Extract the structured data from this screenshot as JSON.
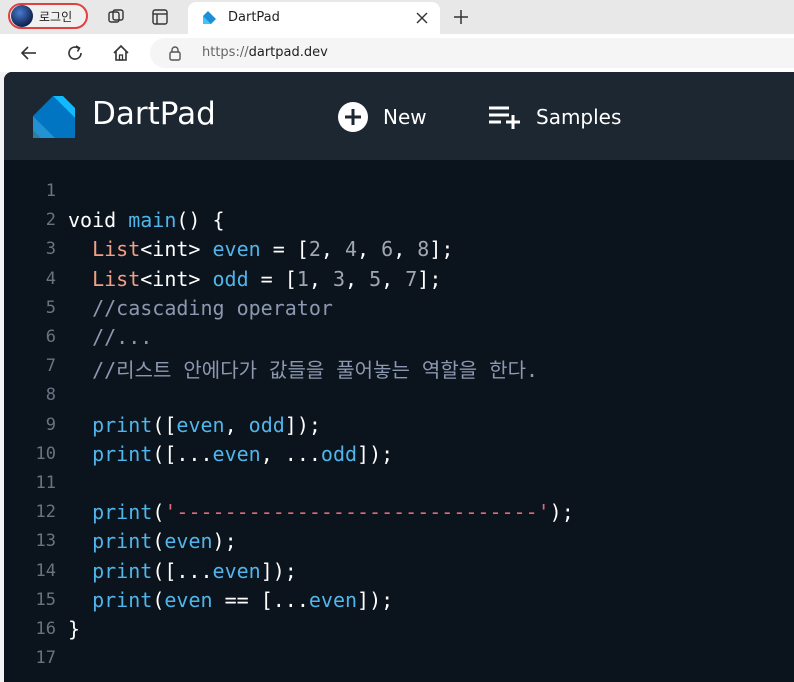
{
  "browser": {
    "profile_label": "로그인",
    "tab_title": "DartPad",
    "url_scheme": "https://",
    "url_host": "dartpad.dev",
    "icons": {
      "workspaces": "workspaces-icon",
      "tab_actions": "tab-actions-icon",
      "close": "close-icon",
      "new_tab": "plus-icon",
      "back": "back-arrow-icon",
      "refresh": "refresh-icon",
      "home": "home-icon",
      "lock": "lock-icon"
    }
  },
  "app": {
    "brand": "DartPad",
    "new_label": "New",
    "samples_label": "Samples",
    "colors": {
      "header_bg": "#1d2731",
      "editor_bg": "#0b131c",
      "function": "#4fb5ea",
      "type": "#f29f86",
      "number": "#a0a7b0",
      "comment": "#8c98b0",
      "string": "#e06a78"
    }
  },
  "editor": {
    "line_numbers": [
      "1",
      "2",
      "3",
      "4",
      "5",
      "6",
      "7",
      "8",
      "9",
      "10",
      "11",
      "12",
      "13",
      "14",
      "15",
      "16",
      "17"
    ],
    "lines": [
      [],
      [
        {
          "t": "void ",
          "c": "kw"
        },
        {
          "t": "main",
          "c": "fn"
        },
        {
          "t": "() {",
          "c": "kw"
        }
      ],
      [
        {
          "t": "  ",
          "c": "kw"
        },
        {
          "t": "List",
          "c": "ty"
        },
        {
          "t": "<int> ",
          "c": "kw"
        },
        {
          "t": "even",
          "c": "fn"
        },
        {
          "t": " = [",
          "c": "kw"
        },
        {
          "t": "2",
          "c": "num"
        },
        {
          "t": ", ",
          "c": "kw"
        },
        {
          "t": "4",
          "c": "num"
        },
        {
          "t": ", ",
          "c": "kw"
        },
        {
          "t": "6",
          "c": "num"
        },
        {
          "t": ", ",
          "c": "kw"
        },
        {
          "t": "8",
          "c": "num"
        },
        {
          "t": "];",
          "c": "kw"
        }
      ],
      [
        {
          "t": "  ",
          "c": "kw"
        },
        {
          "t": "List",
          "c": "ty"
        },
        {
          "t": "<int> ",
          "c": "kw"
        },
        {
          "t": "odd",
          "c": "fn"
        },
        {
          "t": " = [",
          "c": "kw"
        },
        {
          "t": "1",
          "c": "num"
        },
        {
          "t": ", ",
          "c": "kw"
        },
        {
          "t": "3",
          "c": "num"
        },
        {
          "t": ", ",
          "c": "kw"
        },
        {
          "t": "5",
          "c": "num"
        },
        {
          "t": ", ",
          "c": "kw"
        },
        {
          "t": "7",
          "c": "num"
        },
        {
          "t": "];",
          "c": "kw"
        }
      ],
      [
        {
          "t": "  //cascading operator",
          "c": "cm"
        }
      ],
      [
        {
          "t": "  //...",
          "c": "cm"
        }
      ],
      [
        {
          "t": "  //리스트 안에다가 값들을 풀어놓는 역할을 한다.",
          "c": "cm"
        }
      ],
      [],
      [
        {
          "t": "  ",
          "c": "kw"
        },
        {
          "t": "print",
          "c": "fn"
        },
        {
          "t": "([",
          "c": "kw"
        },
        {
          "t": "even",
          "c": "fn"
        },
        {
          "t": ", ",
          "c": "kw"
        },
        {
          "t": "odd",
          "c": "fn"
        },
        {
          "t": "]);",
          "c": "kw"
        }
      ],
      [
        {
          "t": "  ",
          "c": "kw"
        },
        {
          "t": "print",
          "c": "fn"
        },
        {
          "t": "([...",
          "c": "kw"
        },
        {
          "t": "even",
          "c": "fn"
        },
        {
          "t": ", ...",
          "c": "kw"
        },
        {
          "t": "odd",
          "c": "fn"
        },
        {
          "t": "]);",
          "c": "kw"
        }
      ],
      [],
      [
        {
          "t": "  ",
          "c": "kw"
        },
        {
          "t": "print",
          "c": "fn"
        },
        {
          "t": "(",
          "c": "kw"
        },
        {
          "t": "'------------------------------'",
          "c": "str"
        },
        {
          "t": ");",
          "c": "kw"
        }
      ],
      [
        {
          "t": "  ",
          "c": "kw"
        },
        {
          "t": "print",
          "c": "fn"
        },
        {
          "t": "(",
          "c": "kw"
        },
        {
          "t": "even",
          "c": "fn"
        },
        {
          "t": ");",
          "c": "kw"
        }
      ],
      [
        {
          "t": "  ",
          "c": "kw"
        },
        {
          "t": "print",
          "c": "fn"
        },
        {
          "t": "([...",
          "c": "kw"
        },
        {
          "t": "even",
          "c": "fn"
        },
        {
          "t": "]);",
          "c": "kw"
        }
      ],
      [
        {
          "t": "  ",
          "c": "kw"
        },
        {
          "t": "print",
          "c": "fn"
        },
        {
          "t": "(",
          "c": "kw"
        },
        {
          "t": "even",
          "c": "fn"
        },
        {
          "t": " == [...",
          "c": "kw"
        },
        {
          "t": "even",
          "c": "fn"
        },
        {
          "t": "]);",
          "c": "kw"
        }
      ],
      [
        {
          "t": "}",
          "c": "kw"
        }
      ],
      []
    ]
  }
}
